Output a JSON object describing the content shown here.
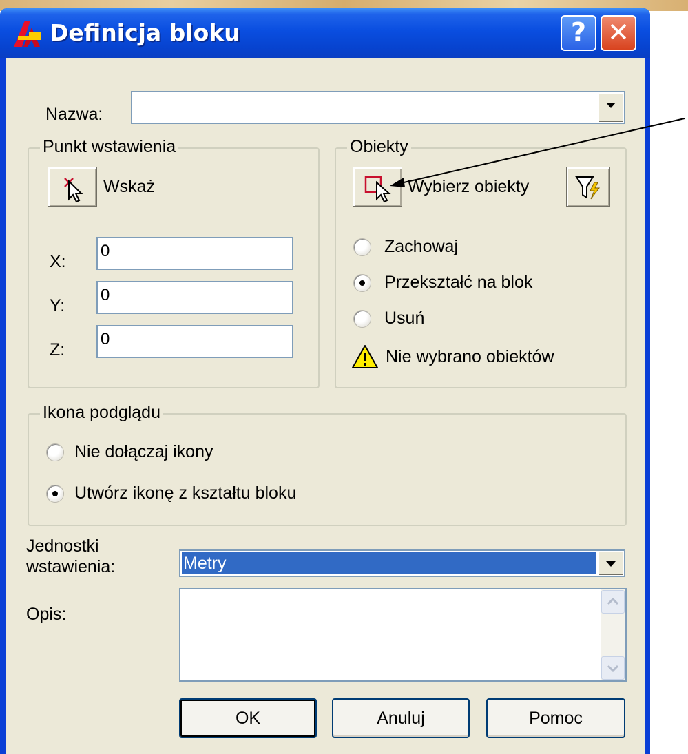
{
  "window": {
    "title": "Definicja bloku",
    "icons": {
      "app": "autocad-logo-icon",
      "help": "help-icon",
      "close": "close-icon"
    },
    "help_glyph": "?",
    "close_glyph": "✕"
  },
  "name_field": {
    "label": "Nazwa:",
    "value": ""
  },
  "insertion_point": {
    "legend": "Punkt wstawienia",
    "pick_label": "Wskaż",
    "pick_icon": "pick-point-icon",
    "x_label": "X:",
    "x_value": "0",
    "y_label": "Y:",
    "y_value": "0",
    "z_label": "Z:",
    "z_value": "0"
  },
  "objects": {
    "legend": "Obiekty",
    "select_label": "Wybierz obiekty",
    "select_icon": "select-objects-icon",
    "filter_icon": "quick-select-filter-icon",
    "options": [
      {
        "label": "Zachowaj",
        "checked": false
      },
      {
        "label": "Przekształć na blok",
        "checked": true
      },
      {
        "label": "Usuń",
        "checked": false
      }
    ],
    "warning_icon": "warning-icon",
    "warning_text": "Nie wybrano obiektów"
  },
  "preview_icon": {
    "legend": "Ikona podglądu",
    "options": [
      {
        "label": "Nie dołączaj ikony",
        "checked": false
      },
      {
        "label": "Utwórz ikonę z kształtu bloku",
        "checked": true
      }
    ]
  },
  "units": {
    "label_line1": "Jednostki",
    "label_line2": "wstawienia:",
    "value": "Metry"
  },
  "description": {
    "label": "Opis:",
    "value": ""
  },
  "buttons": {
    "ok": "OK",
    "cancel": "Anuluj",
    "help": "Pomoc"
  },
  "colors": {
    "title_blue": "#0a4ee0",
    "dialog_face": "#ece9d8",
    "selection": "#316ac5",
    "close_red": "#d8431f"
  }
}
